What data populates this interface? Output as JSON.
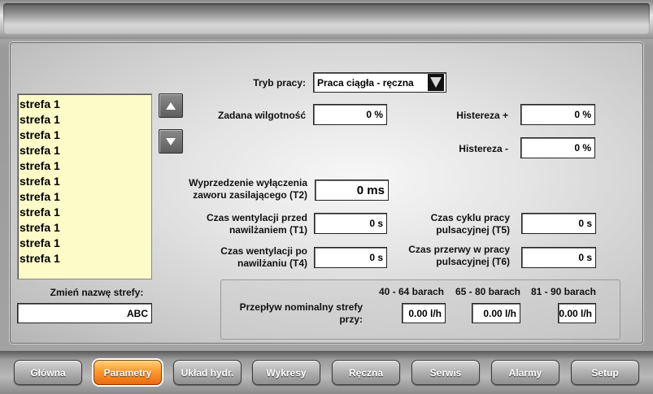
{
  "zone_list": {
    "items": [
      "strefa 1",
      "strefa 1",
      "strefa 1",
      "strefa 1",
      "strefa 1",
      "strefa 1",
      "strefa 1",
      "strefa 1",
      "strefa 1",
      "strefa 1",
      "strefa 1"
    ]
  },
  "rename": {
    "label": "Zmień nazwę strefy:",
    "value": "ABC"
  },
  "mode": {
    "label": "Tryb pracy:",
    "value": "Praca ciągła - ręczna"
  },
  "humidity": {
    "label": "Zadana wilgotność",
    "value": "0 %"
  },
  "hysteresis_plus": {
    "label": "Histereza +",
    "value": "0 %"
  },
  "hysteresis_minus": {
    "label": "Histereza -",
    "value": "0 %"
  },
  "t2": {
    "label_line1": "Wyprzedzenie wyłączenia",
    "label_line2": "zaworu zasilającego (T2)",
    "value": "0 ms"
  },
  "t1": {
    "label_line1": "Czas wentylacji przed",
    "label_line2": "nawilżaniem (T1)",
    "value": "0 s"
  },
  "t4": {
    "label_line1": "Czas wentylacji po",
    "label_line2": "nawilżaniu (T4)",
    "value": "0 s"
  },
  "t5": {
    "label_line1": "Czas cyklu pracy",
    "label_line2": "pulsacyjnej (T5)",
    "value": "0 s"
  },
  "t6": {
    "label_line1": "Czas przerwy w pracy",
    "label_line2": "pulsacyjnej (T6)",
    "value": "0 s"
  },
  "flow": {
    "label_line1": "Przepływ nominalny strefy",
    "label_line2": "przy:",
    "headers": [
      "40 - 64 barach",
      "65 - 80 barach",
      "81 - 90 barach"
    ],
    "values": [
      "0.00 l/h",
      "0.00 l/h",
      "0.00 l/h"
    ]
  },
  "nav": {
    "buttons": [
      "Główna",
      "Parametry",
      "Układ hydr.",
      "Wykresy",
      "Ręczna",
      "Serwis",
      "Alarmy",
      "Setup"
    ],
    "active": "Parametry"
  },
  "icons": {
    "scroll_up": "arrow-up-icon",
    "scroll_down": "arrow-down-icon",
    "dropdown": "dropdown-arrow-icon"
  },
  "colors": {
    "active_tab": "#ff9a2e",
    "list_bg": "#fdfcc8"
  }
}
